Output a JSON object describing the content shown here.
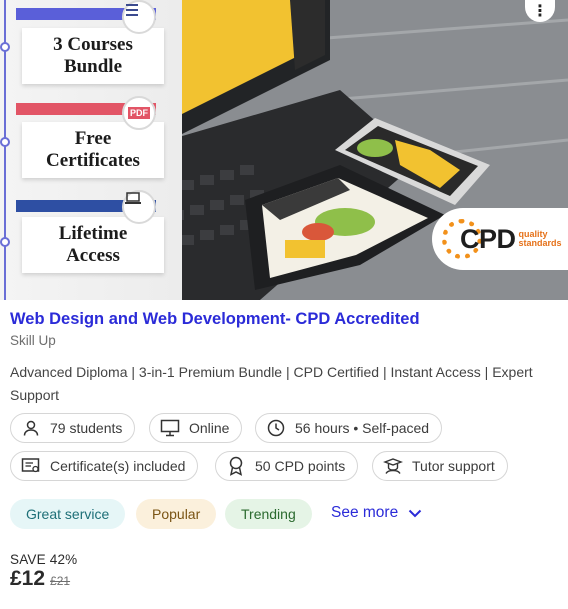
{
  "hero": {
    "banners": [
      {
        "text": "3 Courses\nBundle",
        "accent": "#5a5fd9",
        "icon": "list-icon"
      },
      {
        "text": "Free\nCertificates",
        "accent": "#e25566",
        "icon": "pdf-icon"
      },
      {
        "text": "Lifetime\nAccess",
        "accent": "#2e4fa3",
        "icon": "laptop-icon"
      }
    ],
    "pdf_icon_label": "PDF",
    "cpd_badge": {
      "text": "CPD",
      "sub": "quality\nstandards"
    },
    "menu_glyph": "⋮"
  },
  "course": {
    "title": "Web Design and Web Development- CPD Accredited",
    "provider": "Skill Up",
    "description": "Advanced Diploma | 3-in-1 Premium Bundle | CPD Certified | Instant Access | Expert Support"
  },
  "chips": [
    {
      "label": "79 students",
      "icon": "person-icon"
    },
    {
      "label": "Online",
      "icon": "monitor-icon"
    },
    {
      "label": "56 hours • Self-paced",
      "icon": "clock-icon"
    },
    {
      "label": "Certificate(s) included",
      "icon": "certificate-icon"
    },
    {
      "label": "50 CPD points",
      "icon": "award-icon"
    },
    {
      "label": "Tutor support",
      "icon": "tutor-icon"
    }
  ],
  "tags": [
    {
      "label": "Great service",
      "bg": "#e6f6f7",
      "color": "#1d6f77"
    },
    {
      "label": "Popular",
      "bg": "#fbf0dc",
      "color": "#7a5414"
    },
    {
      "label": "Trending",
      "bg": "#e5f4e6",
      "color": "#2b6a2f"
    }
  ],
  "see_more": "See more",
  "pricing": {
    "save": "SAVE 42%",
    "current": "£12",
    "original": "£21"
  },
  "colors": {
    "link": "#2b2bd8",
    "text": "#2b2b2b",
    "muted": "#6e6e6e",
    "chip_border": "#d6d6d6"
  }
}
